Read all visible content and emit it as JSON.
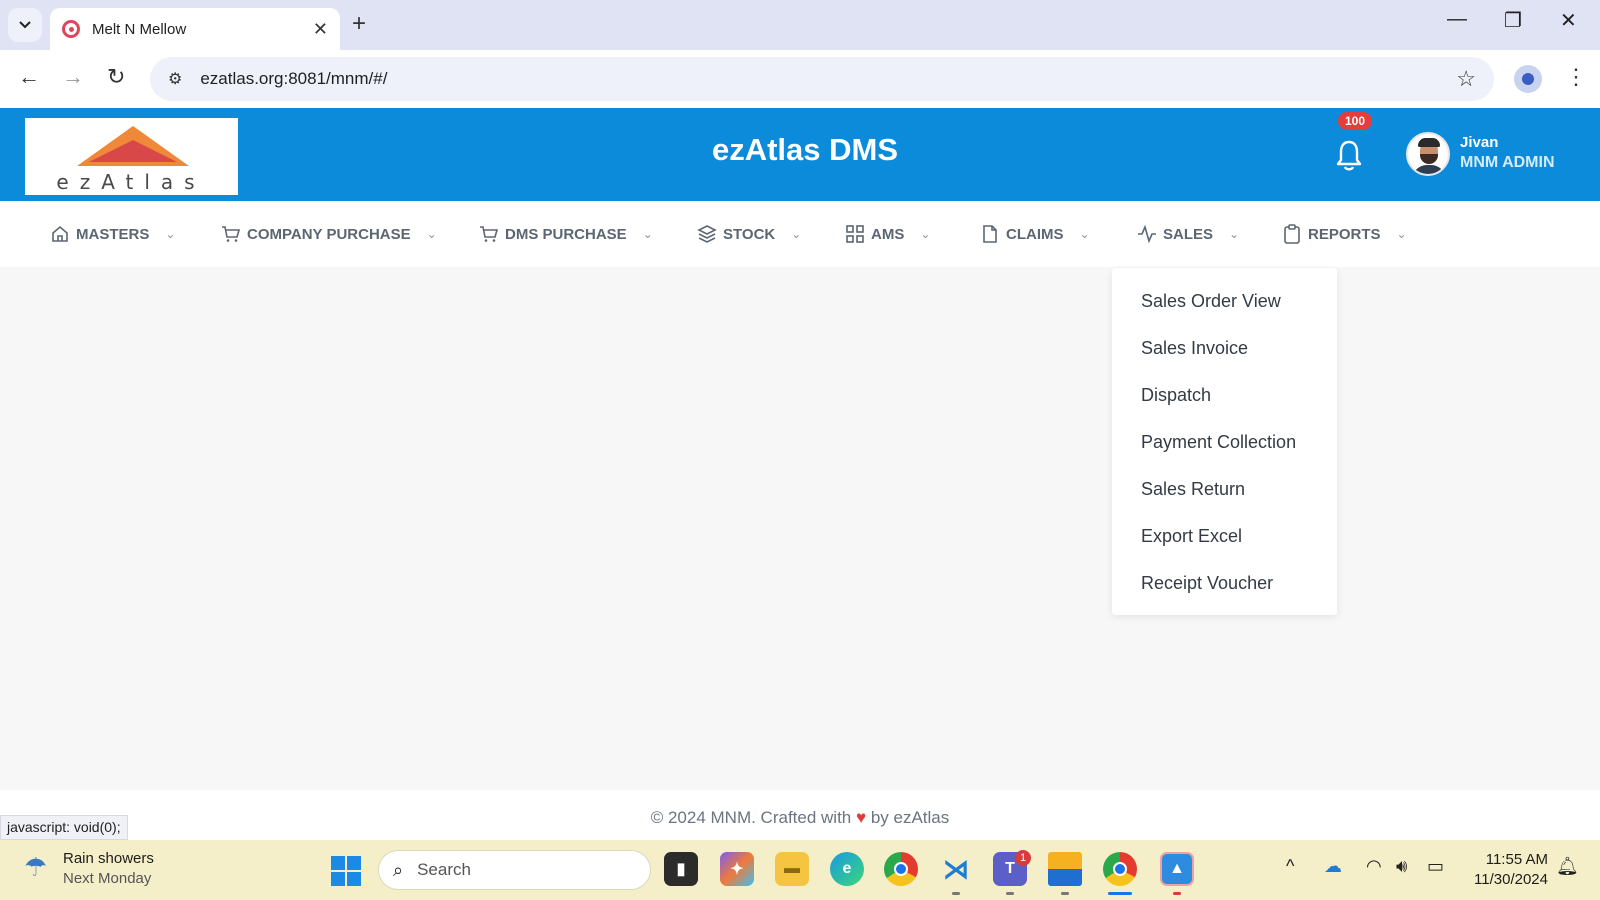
{
  "browser": {
    "tab_title": "Melt N Mellow",
    "url": "ezatlas.org:8081/mnm/#/",
    "status_link": "javascript: void(0);"
  },
  "header": {
    "logo_text": "ezAtlas",
    "title": "ezAtlas DMS",
    "notification_count": "100",
    "user_name": "Jivan",
    "user_role": "MNM ADMIN",
    "accent_color": "#0b8bd9"
  },
  "nav": {
    "items": [
      {
        "label": "MASTERS",
        "icon": "home-icon"
      },
      {
        "label": "COMPANY PURCHASE",
        "icon": "cart-icon"
      },
      {
        "label": "DMS PURCHASE",
        "icon": "cart-icon"
      },
      {
        "label": "STOCK",
        "icon": "layers-icon"
      },
      {
        "label": "AMS",
        "icon": "grid-icon"
      },
      {
        "label": "CLAIMS",
        "icon": "file-icon"
      },
      {
        "label": "SALES",
        "icon": "activity-icon"
      },
      {
        "label": "REPORTS",
        "icon": "clipboard-icon"
      }
    ]
  },
  "sales_menu": {
    "items": [
      "Sales Order View",
      "Sales Invoice",
      "Dispatch",
      "Payment Collection",
      "Sales Return",
      "Export Excel",
      "Receipt Voucher"
    ]
  },
  "footer": {
    "prefix": "© 2024 MNM. Crafted with",
    "suffix": "by ezAtlas"
  },
  "taskbar": {
    "weather_title": "Rain showers",
    "weather_sub": "Next Monday",
    "search_label": "Search",
    "teams_badge": "1",
    "time": "11:55 AM",
    "date": "11/30/2024"
  }
}
